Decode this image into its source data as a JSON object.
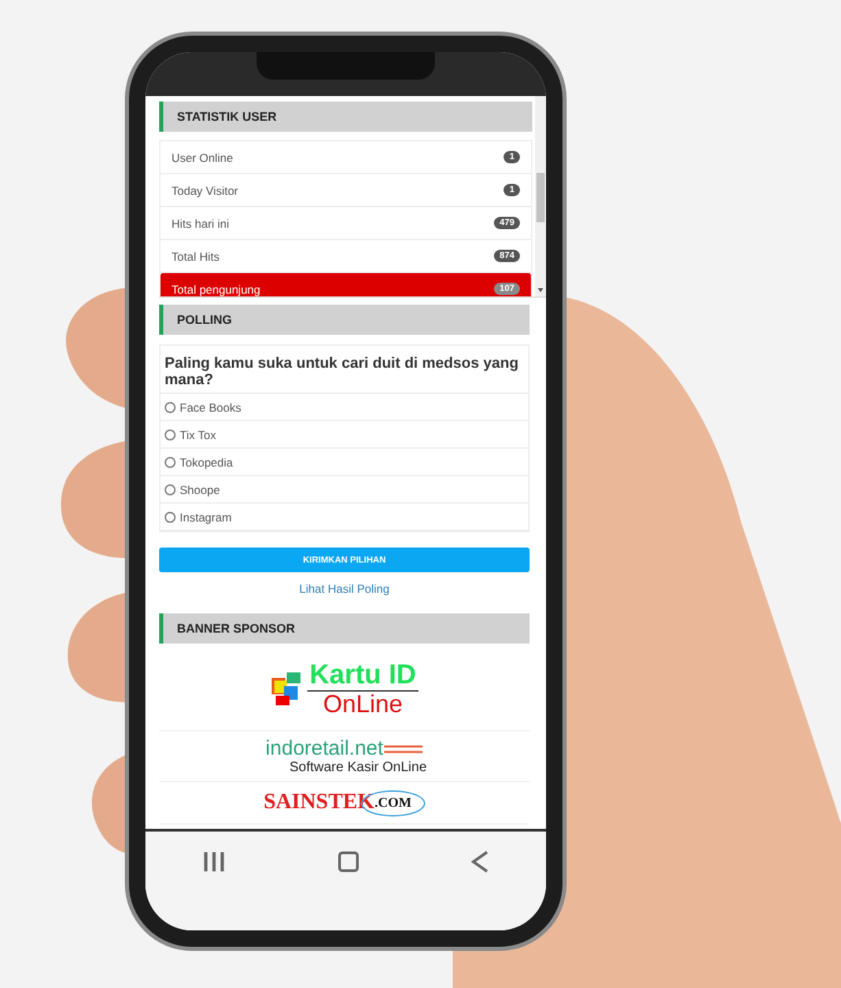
{
  "stats": {
    "title": "STATISTIK USER",
    "rows": [
      {
        "label": "User Online",
        "count": "1",
        "highlighted": false
      },
      {
        "label": "Today Visitor",
        "count": "1",
        "highlighted": false
      },
      {
        "label": "Hits hari ini",
        "count": "479",
        "highlighted": false
      },
      {
        "label": "Total Hits",
        "count": "874",
        "highlighted": false
      },
      {
        "label": "Total pengunjung",
        "count": "107",
        "highlighted": true
      }
    ]
  },
  "poll": {
    "title": "POLLING",
    "question": "Paling kamu suka untuk cari duit di medsos yang mana?",
    "options": [
      {
        "label": "Face Books",
        "selected": false
      },
      {
        "label": "Tix Tox",
        "selected": false
      },
      {
        "label": "Tokopedia",
        "selected": false
      },
      {
        "label": "Shoope",
        "selected": false
      },
      {
        "label": "Instagram",
        "selected": false
      }
    ],
    "submit": "KIRIMKAN PILIHAN",
    "results_link": "Lihat Hasil Poling"
  },
  "sponsors": {
    "title": "BANNER SPONSOR",
    "banners": [
      {
        "kind": "kartu",
        "line1": "Kartu ID",
        "line2": "OnLine"
      },
      {
        "kind": "indoretail",
        "line1": "indoretail.net",
        "line2": "Software Kasir OnLine"
      },
      {
        "kind": "sainstek",
        "line1": "SAINSTEK",
        "line2": ".COM"
      }
    ]
  }
}
